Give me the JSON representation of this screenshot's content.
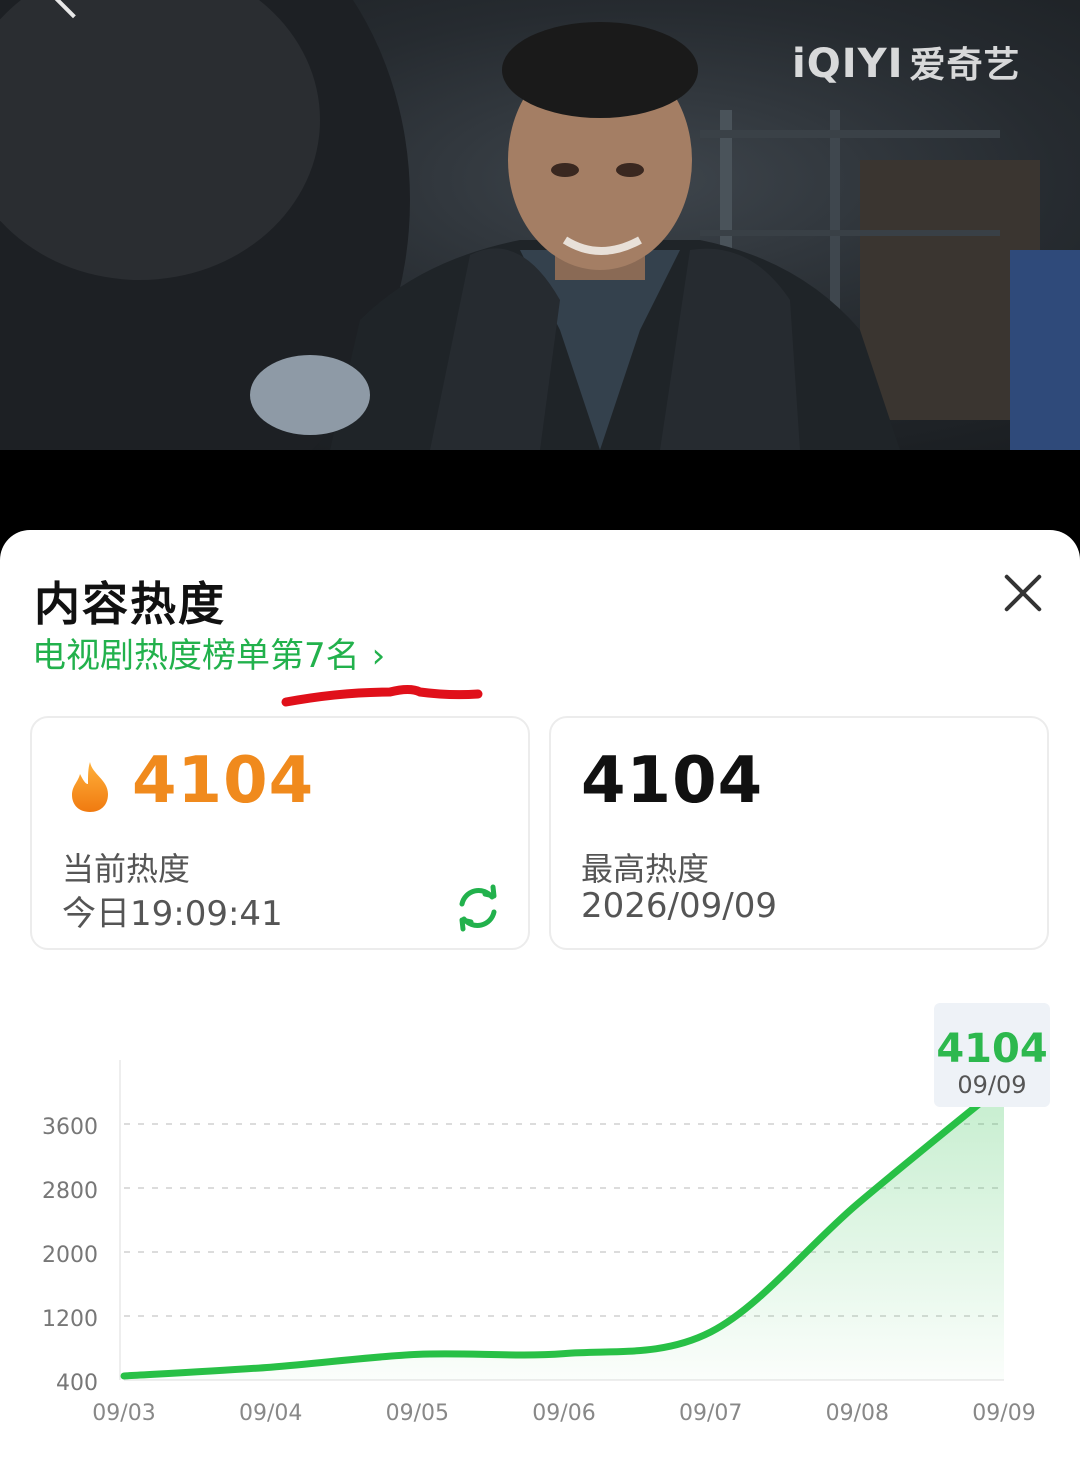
{
  "brand": {
    "logo_text": "iQIYI",
    "logo_cn": "爱奇艺"
  },
  "video": {
    "scene": "dark warehouse scene, smiling young man in dark hooded jacket"
  },
  "sheet": {
    "title": "内容热度",
    "rank_link": "电视剧热度榜单第7名",
    "current": {
      "value": "4104",
      "label": "当前热度",
      "time": "今日19:09:41"
    },
    "highest": {
      "value": "4104",
      "label": "最高热度",
      "date": "2026/09/09"
    },
    "tooltip": {
      "value": "4104",
      "date": "09/09"
    }
  },
  "colors": {
    "accent_green": "#22b14c",
    "line_green": "#28c046",
    "orange": "#f08a1d",
    "annotation_red": "#e0101a"
  },
  "icons": [
    "back-chevron-icon",
    "close-icon",
    "chevron-right-icon",
    "flame-icon",
    "refresh-icon"
  ],
  "chart_data": {
    "type": "area",
    "categories": [
      "09/03",
      "09/04",
      "09/05",
      "09/06",
      "09/07",
      "09/08",
      "09/09"
    ],
    "y_ticks": [
      400,
      1200,
      2000,
      2800,
      3600
    ],
    "ylim": [
      400,
      4400
    ],
    "series": [
      {
        "points": [
          {
            "x": "09/03",
            "y": 450
          },
          {
            "x": "09/04",
            "y": 560
          },
          {
            "x": "09/05",
            "y": 720
          },
          {
            "x": "09/06",
            "y": 730
          },
          {
            "x": "09/07",
            "y": 1000
          },
          {
            "x": "09/08",
            "y": 2600
          },
          {
            "x": "09/09",
            "y": 4104
          }
        ]
      }
    ],
    "grid": true,
    "highlight": {
      "x": "09/09",
      "y": 4104
    }
  }
}
